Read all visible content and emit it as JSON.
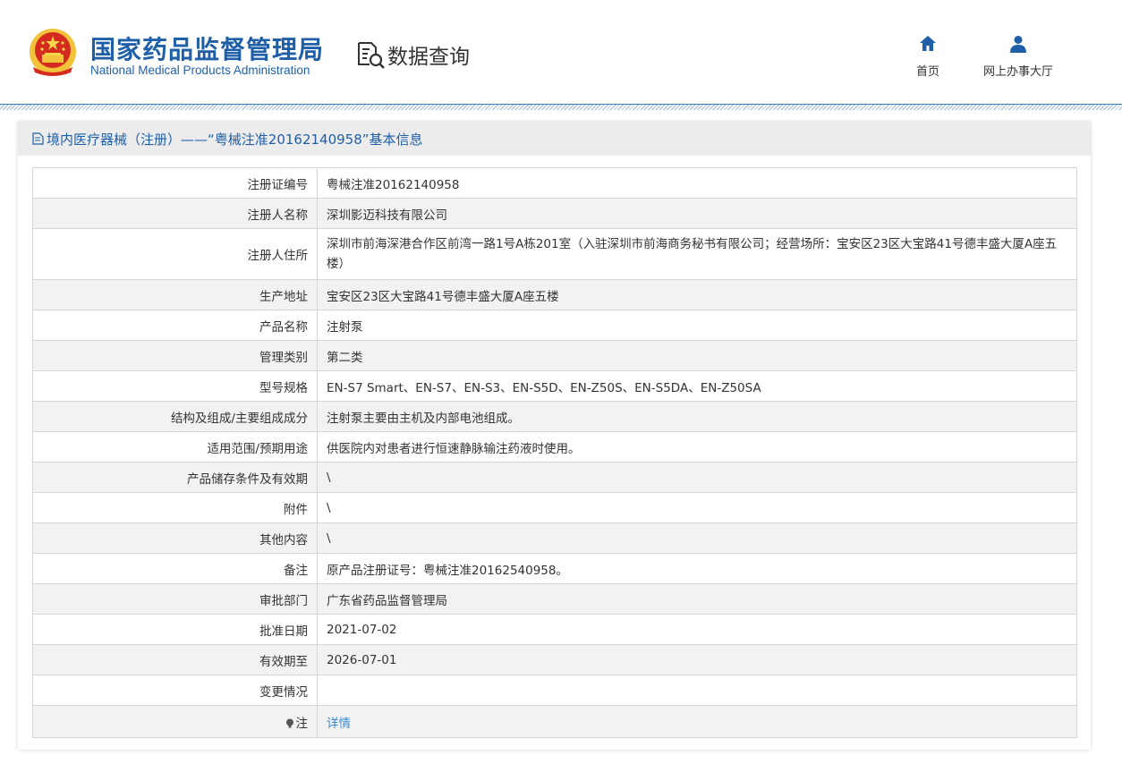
{
  "header": {
    "title_cn": "国家药品监督管理局",
    "title_en": "National Medical Products Administration",
    "query_label": "数据查询",
    "nav": [
      {
        "label": "首页",
        "icon": "home-icon"
      },
      {
        "label": "网上办事大厅",
        "icon": "user-icon"
      }
    ]
  },
  "panel": {
    "title": "境内医疗器械（注册）——“粤械注准20162140958”基本信息"
  },
  "rows": [
    {
      "key": "注册证编号",
      "value": "粤械注准20162140958"
    },
    {
      "key": "注册人名称",
      "value": "深圳影迈科技有限公司"
    },
    {
      "key": "注册人住所",
      "value": "深圳市前海深港合作区前湾一路1号A栋201室（入驻深圳市前海商务秘书有限公司；经营场所：宝安区23区大宝路41号德丰盛大厦A座五楼）"
    },
    {
      "key": "生产地址",
      "value": "宝安区23区大宝路41号德丰盛大厦A座五楼"
    },
    {
      "key": "产品名称",
      "value": "注射泵"
    },
    {
      "key": "管理类别",
      "value": "第二类"
    },
    {
      "key": "型号规格",
      "value": "EN-S7 Smart、EN-S7、EN-S3、EN-S5D、EN-Z50S、EN-S5DA、EN-Z50SA"
    },
    {
      "key": "结构及组成/主要组成成分",
      "value": "注射泵主要由主机及内部电池组成。"
    },
    {
      "key": "适用范围/预期用途",
      "value": "供医院内对患者进行恒速静脉输注药液时使用。"
    },
    {
      "key": "产品储存条件及有效期",
      "value": "\\"
    },
    {
      "key": "附件",
      "value": "\\"
    },
    {
      "key": "其他内容",
      "value": "\\"
    },
    {
      "key": "备注",
      "value": "原产品注册证号：粤械注准20162540958。"
    },
    {
      "key": "审批部门",
      "value": "广东省药品监督管理局"
    },
    {
      "key": "批准日期",
      "value": "2021-07-02"
    },
    {
      "key": "有效期至",
      "value": "2026-07-01"
    },
    {
      "key": "变更情况",
      "value": ""
    }
  ],
  "note_row": {
    "key": "注",
    "link": "详情"
  },
  "colors": {
    "brand_blue": "#1f5fa8",
    "link_blue": "#3a8ad6",
    "emblem_red": "#d42a1f",
    "emblem_gold": "#f2c23a"
  }
}
